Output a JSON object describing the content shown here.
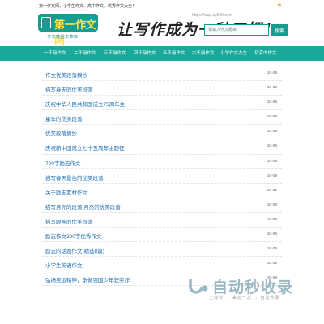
{
  "topbar": {
    "tagline": "第一作文网，小学生作文、高中作文、优秀作文大全！"
  },
  "header": {
    "logo_text": "第一作文网",
    "logo_sub": "作文精品文章库",
    "slogan": "让写作成为一种习惯！",
    "site_url": "https://wap.zy580.com",
    "search": {
      "placeholder": "请输入作文题目",
      "button_label": "搜索"
    }
  },
  "nav": {
    "items": [
      "一年级作文",
      "二年级作文",
      "三年级作文",
      "四年级作文",
      "五年级作文",
      "六年级作文",
      "小学作文大全",
      "初高中作文"
    ]
  },
  "articles": [
    {
      "title": "作文优美段落摘抄",
      "date": "10-09"
    },
    {
      "title": "描写春天的优美段落",
      "date": "10-09"
    },
    {
      "title": "庆祝中华人民共和国成立75周年主",
      "date": "10-09"
    },
    {
      "title": "童年的优美段落",
      "date": "10-09"
    },
    {
      "title": "优美段落摘抄",
      "date": "10-09"
    },
    {
      "title": "庆祝新中国成立七十五周年主题征",
      "date": "10-09"
    },
    {
      "title": "700字励志作文",
      "date": "10-09"
    },
    {
      "title": "描写春天景色的优美段落",
      "date": "10-09"
    },
    {
      "title": "关于励志素材作文",
      "date": "10-09"
    },
    {
      "title": "描写月亮的段落 月亮的优美段落",
      "date": "10-09"
    },
    {
      "title": "描写眼神的优美段落",
      "date": "10-09"
    },
    {
      "title": "励志作文300字优秀作文",
      "date": "10-09"
    },
    {
      "title": "励志的话题作文(精选8篇)",
      "date": "10-09"
    },
    {
      "title": "小学生英语作文",
      "date": "10-09"
    },
    {
      "title": "弘扬奥运精神，争做强国少年获奖作",
      "date": "10-09"
    }
  ],
  "watermark": {
    "text": "自动秒收录",
    "sub": "上线秒 → 来访一次 → 自动秒录"
  },
  "colors": {
    "accent": "#19a89a",
    "link": "#1f6fb2"
  }
}
